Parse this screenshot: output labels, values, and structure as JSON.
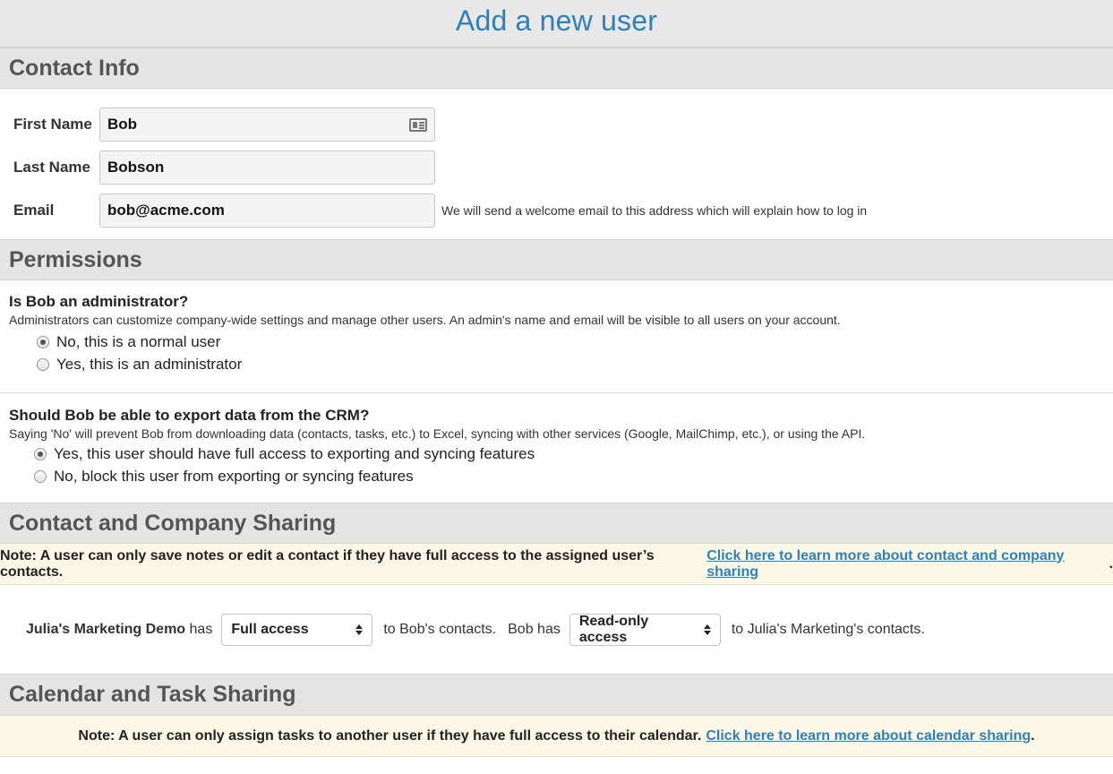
{
  "page": {
    "title": "Add a new user"
  },
  "contact_info": {
    "heading": "Contact Info",
    "first_name": {
      "label": "First Name",
      "value": "Bob",
      "icon": "contact-card-icon"
    },
    "last_name": {
      "label": "Last Name",
      "value": "Bobson"
    },
    "email": {
      "label": "Email",
      "value": "bob@acme.com",
      "hint": "We will send a welcome email to this address which will explain how to log in"
    }
  },
  "permissions": {
    "heading": "Permissions",
    "admin": {
      "question": "Is Bob an administrator?",
      "description": "Administrators can customize company-wide settings and manage other users. An admin's name and email will be visible to all users on your account.",
      "options": [
        {
          "label": "No, this is a normal user",
          "checked": true
        },
        {
          "label": "Yes, this is an administrator",
          "checked": false
        }
      ]
    },
    "export": {
      "question": "Should Bob be able to export data from the CRM?",
      "description": "Saying 'No' will prevent Bob from downloading data (contacts, tasks, etc.) to Excel, syncing with other services (Google, MailChimp, etc.), or using the API.",
      "options": [
        {
          "label": "Yes, this user should have full access to exporting and syncing features",
          "checked": true
        },
        {
          "label": "No, block this user from exporting or syncing features",
          "checked": false
        }
      ]
    }
  },
  "contact_sharing": {
    "heading": "Contact and Company Sharing",
    "note": "Note: A user can only save notes or edit a contact if they have full access to the assigned user’s contacts.",
    "note_link": "Click here to learn more about contact and company sharing",
    "note_end": ".",
    "owner_name": "Julia's Marketing Demo",
    "has_text": "has",
    "owner_access": "Full access",
    "to_bob_text": "to Bob's contacts.",
    "bob_has_text": "Bob has",
    "bob_access": "Read-only access",
    "to_julia_text": "to Julia's Marketing's contacts."
  },
  "calendar_sharing": {
    "heading": "Calendar and Task Sharing",
    "note": "Note: A user can only assign tasks to another user if they have full access to their calendar.",
    "note_link": "Click here to learn more about calendar sharing",
    "note_end": "."
  },
  "colors": {
    "accent": "#2f80b9",
    "section_bg": "#e4e4e4",
    "note_bg": "#fbf8e8"
  }
}
